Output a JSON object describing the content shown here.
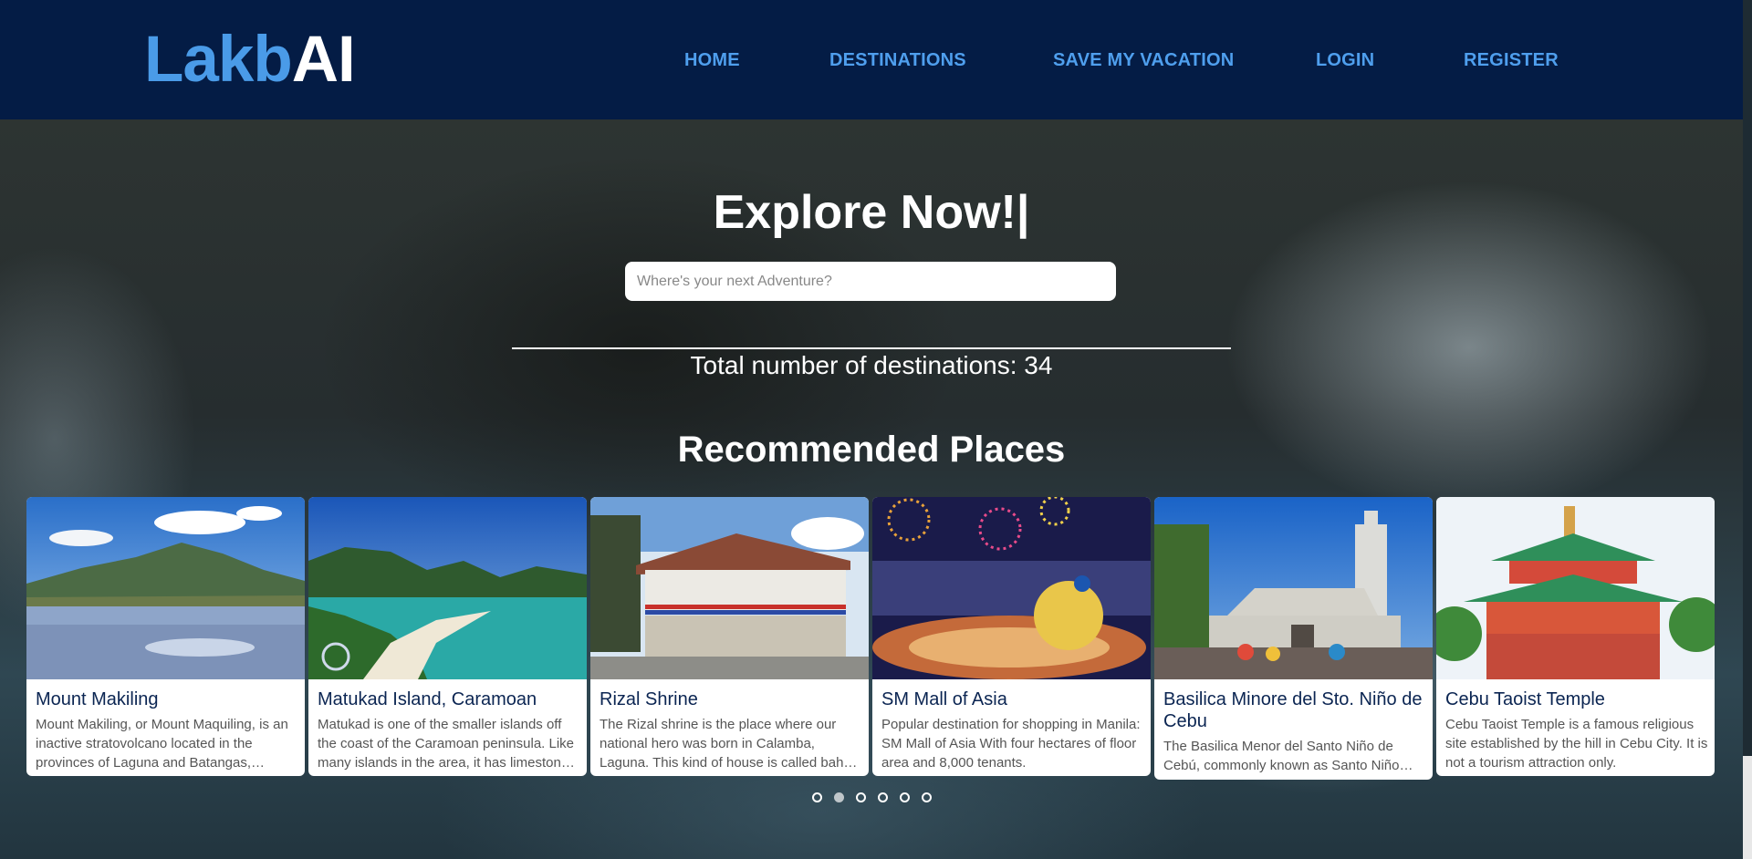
{
  "brand": {
    "part1": "Lakb",
    "part2": "AI"
  },
  "nav": {
    "home": "HOME",
    "destinations": "DESTINATIONS",
    "save_vacation": "SAVE MY VACATION",
    "login": "LOGIN",
    "register": "REGISTER"
  },
  "hero": {
    "title": "Explore Now!|",
    "search_placeholder": "Where's your next Adventure?",
    "total_text": "Total number of destinations: 34",
    "recommended_title": "Recommended Places"
  },
  "cards": [
    {
      "title": "Mount Makiling",
      "desc": "Mount Makiling, or Mount Maquiling, is an inactive stratovolcano located in the provinces of Laguna and Batangas, Philippines."
    },
    {
      "title": "Matukad Island, Caramoan",
      "desc": "Matukad is one of the smaller islands off the coast of the Caramoan peninsula. Like many islands in the area, it has limestone cliffs."
    },
    {
      "title": "Rizal Shrine",
      "desc": "The Rizal shrine is the place where our national hero was born in Calamba, Laguna. This kind of house is called bahay na bato."
    },
    {
      "title": "SM Mall of Asia",
      "desc": "Popular destination for shopping in Manila: SM Mall of Asia With four hectares of floor area and 8,000 tenants."
    },
    {
      "title": "Basilica Minore del Sto. Niño de Cebu",
      "desc": "The Basilica Menor del Santo Niño de Cebú, commonly known as Santo Niño Basilica."
    },
    {
      "title": "Cebu Taoist Temple",
      "desc": "Cebu Taoist Temple is a famous religious site established by the hill in Cebu City. It is not a tourism attraction only."
    }
  ],
  "carousel": {
    "dot_count": 6,
    "active_index": 1
  }
}
